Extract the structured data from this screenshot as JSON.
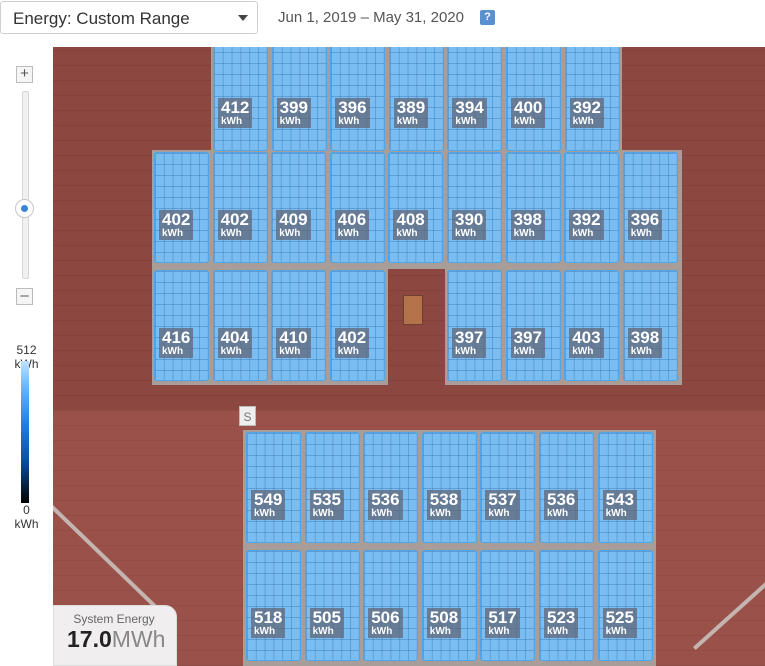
{
  "toolbar": {
    "view_select": "Energy: Custom Range",
    "date_range": "Jun 1, 2019 – May 31, 2020",
    "help_label": "?"
  },
  "zoom": {
    "in_label": "+",
    "out_label": "–",
    "level": 0.37
  },
  "legend": {
    "max_value": "512",
    "max_unit": "kWh",
    "min_value": "0",
    "min_unit": "kWh"
  },
  "string_marker": "S",
  "summary": {
    "title": "System Energy",
    "value": "17.0",
    "unit": "MWh"
  },
  "colors": {
    "panel": "#79bdf2",
    "roof": "#8b4740",
    "accent": "#3a84d8"
  },
  "panel_unit": "kWh",
  "panels": {
    "upper_top": [
      "412",
      "399",
      "396",
      "389",
      "394",
      "400",
      "392"
    ],
    "upper_middle": [
      "402",
      "402",
      "409",
      "406",
      "408",
      "390",
      "398",
      "392",
      "396"
    ],
    "upper_bottom_left": [
      "416",
      "404",
      "410",
      "402"
    ],
    "upper_bottom_right": [
      "397",
      "397",
      "403",
      "398"
    ],
    "lower_top": [
      "549",
      "535",
      "536",
      "538",
      "537",
      "536",
      "543"
    ],
    "lower_bottom": [
      "518",
      "505",
      "506",
      "508",
      "517",
      "523",
      "525"
    ]
  }
}
